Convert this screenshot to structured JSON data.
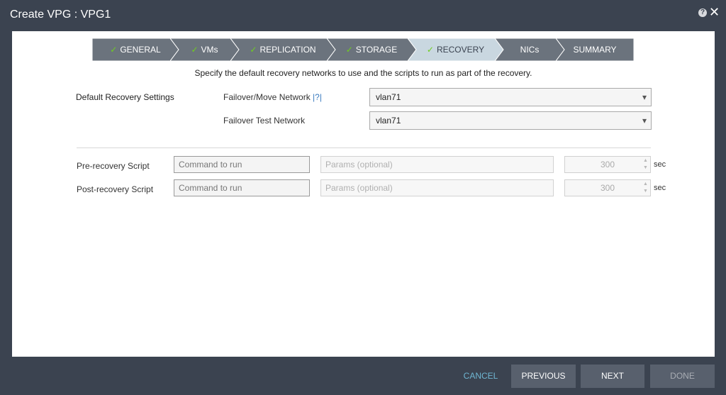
{
  "window": {
    "title": "Create VPG : VPG1"
  },
  "steps": [
    {
      "label": "GENERAL",
      "completed": true,
      "active": false
    },
    {
      "label": "VMs",
      "completed": true,
      "active": false
    },
    {
      "label": "REPLICATION",
      "completed": true,
      "active": false
    },
    {
      "label": "STORAGE",
      "completed": true,
      "active": false
    },
    {
      "label": "RECOVERY",
      "completed": true,
      "active": true
    },
    {
      "label": "NICs",
      "completed": false,
      "active": false
    },
    {
      "label": "SUMMARY",
      "completed": false,
      "active": false
    }
  ],
  "description": "Specify the default recovery networks to use and the scripts to run as part of the recovery.",
  "defaults": {
    "section_label": "Default Recovery Settings",
    "failover_label": "Failover/Move Network",
    "failover_help": "|?|",
    "failover_value": "vlan71",
    "test_label": "Failover Test Network",
    "test_value": "vlan71"
  },
  "scripts": {
    "pre": {
      "label": "Pre-recovery Script",
      "command_placeholder": "Command to run",
      "params_placeholder": "Params (optional)",
      "timeout": "300",
      "unit": "sec"
    },
    "post": {
      "label": "Post-recovery Script",
      "command_placeholder": "Command to run",
      "params_placeholder": "Params (optional)",
      "timeout": "300",
      "unit": "sec"
    }
  },
  "footer": {
    "cancel": "CANCEL",
    "previous": "PREVIOUS",
    "next": "NEXT",
    "done": "DONE"
  },
  "colors": {
    "background": "#3b4350",
    "step_inactive": "#6b737d",
    "step_active": "#c9d7e0",
    "check": "#6fce1f",
    "cancel_link": "#6fb6d2",
    "button": "#58606d"
  },
  "icons": {
    "help": "help-icon",
    "close": "close-icon",
    "check": "check-icon",
    "dropdown": "chevron-down-icon"
  }
}
